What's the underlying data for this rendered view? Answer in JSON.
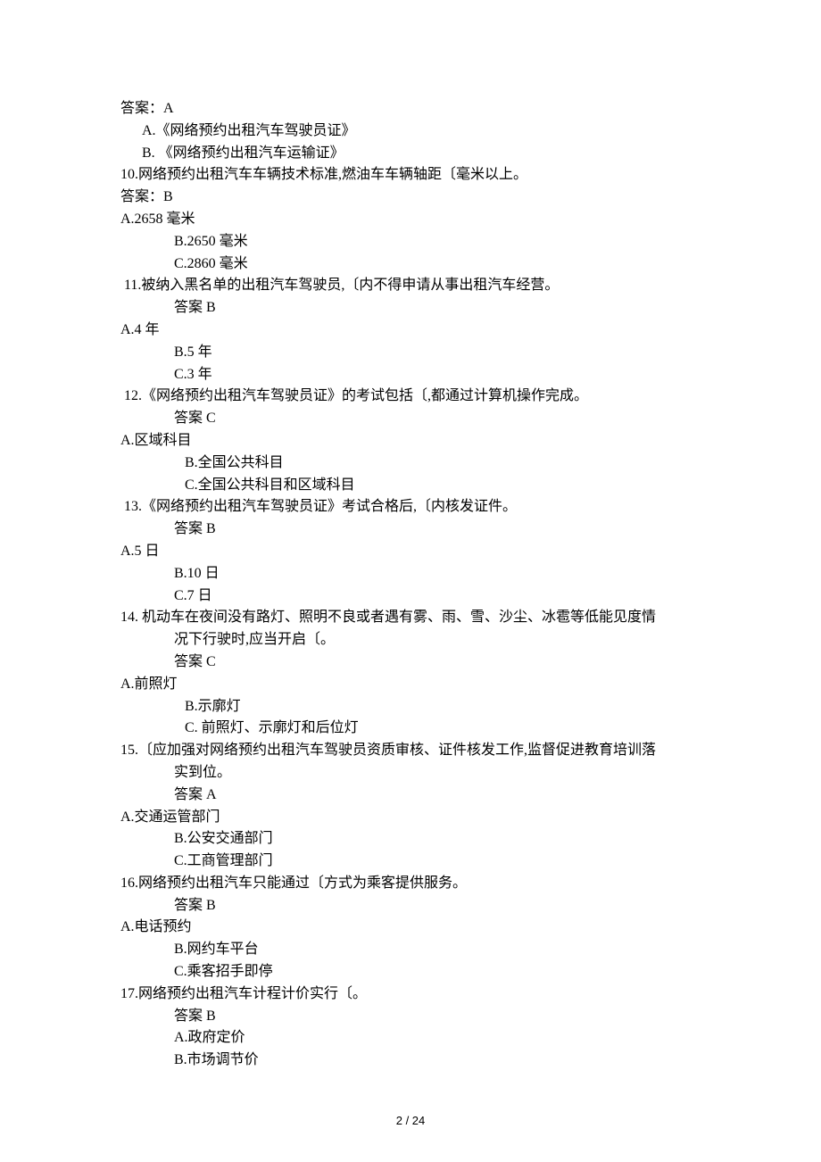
{
  "q9": {
    "answer": "答案：A",
    "optA": "A.《网络预约出租汽车驾驶员证》",
    "optB": "B. 《网络预约出租汽车运输证》"
  },
  "q10": {
    "text": "10.网络预约出租汽车车辆技术标准,燃油车车辆轴距〔毫米以上。",
    "answer": "答案：B",
    "optA": "A.2658 毫米",
    "optB": "B.2650 毫米",
    "optC": "C.2860 毫米"
  },
  "q11": {
    "text": " 11.被纳入黑名单的出租汽车驾驶员,〔内不得申请从事出租汽车经营。",
    "answer": "答案 B",
    "optA": "A.4 年",
    "optB": "B.5 年",
    "optC": "C.3 年"
  },
  "q12": {
    "text": " 12.《网络预约出租汽车驾驶员证》的考试包括〔,都通过计算机操作完成。",
    "answer": "答案 C",
    "optA": "A.区域科目",
    "optB": "B.全国公共科目",
    "optC": "C.全国公共科目和区域科目"
  },
  "q13": {
    "text": " 13.《网络预约出租汽车驾驶员证》考试合格后,〔内核发证件。",
    "answer": "答案 B",
    "optA": "A.5 日",
    "optB": "B.10 日",
    "optC": "C.7 日"
  },
  "q14": {
    "text1": "14. 机动车在夜间没有路灯、照明不良或者遇有雾、雨、雪、沙尘、冰雹等低能见度情",
    "text2": "况下行驶时,应当开启〔。",
    "answer": "答案 C",
    "optA": "A.前照灯",
    "optB": "B.示廓灯",
    "optC": "C. 前照灯、示廓灯和后位灯"
  },
  "q15": {
    "text1": "15.〔应加强对网络预约出租汽车驾驶员资质审核、证件核发工作,监督促进教育培训落",
    "text2": "实到位。",
    "answer": "答案 A",
    "optA": "A.交通运管部门",
    "optB": "B.公安交通部门",
    "optC": "C.工商管理部门"
  },
  "q16": {
    "text": "16.网络预约出租汽车只能通过〔方式为乘客提供服务。",
    "answer": "答案 B",
    "optA": "A.电话预约",
    "optB": "B.网约车平台",
    "optC": "C.乘客招手即停"
  },
  "q17": {
    "text": "17.网络预约出租汽车计程计价实行〔。",
    "answer": "答案 B",
    "optA": "A.政府定价",
    "optB": "B.市场调节价"
  },
  "footer": "2 / 24"
}
